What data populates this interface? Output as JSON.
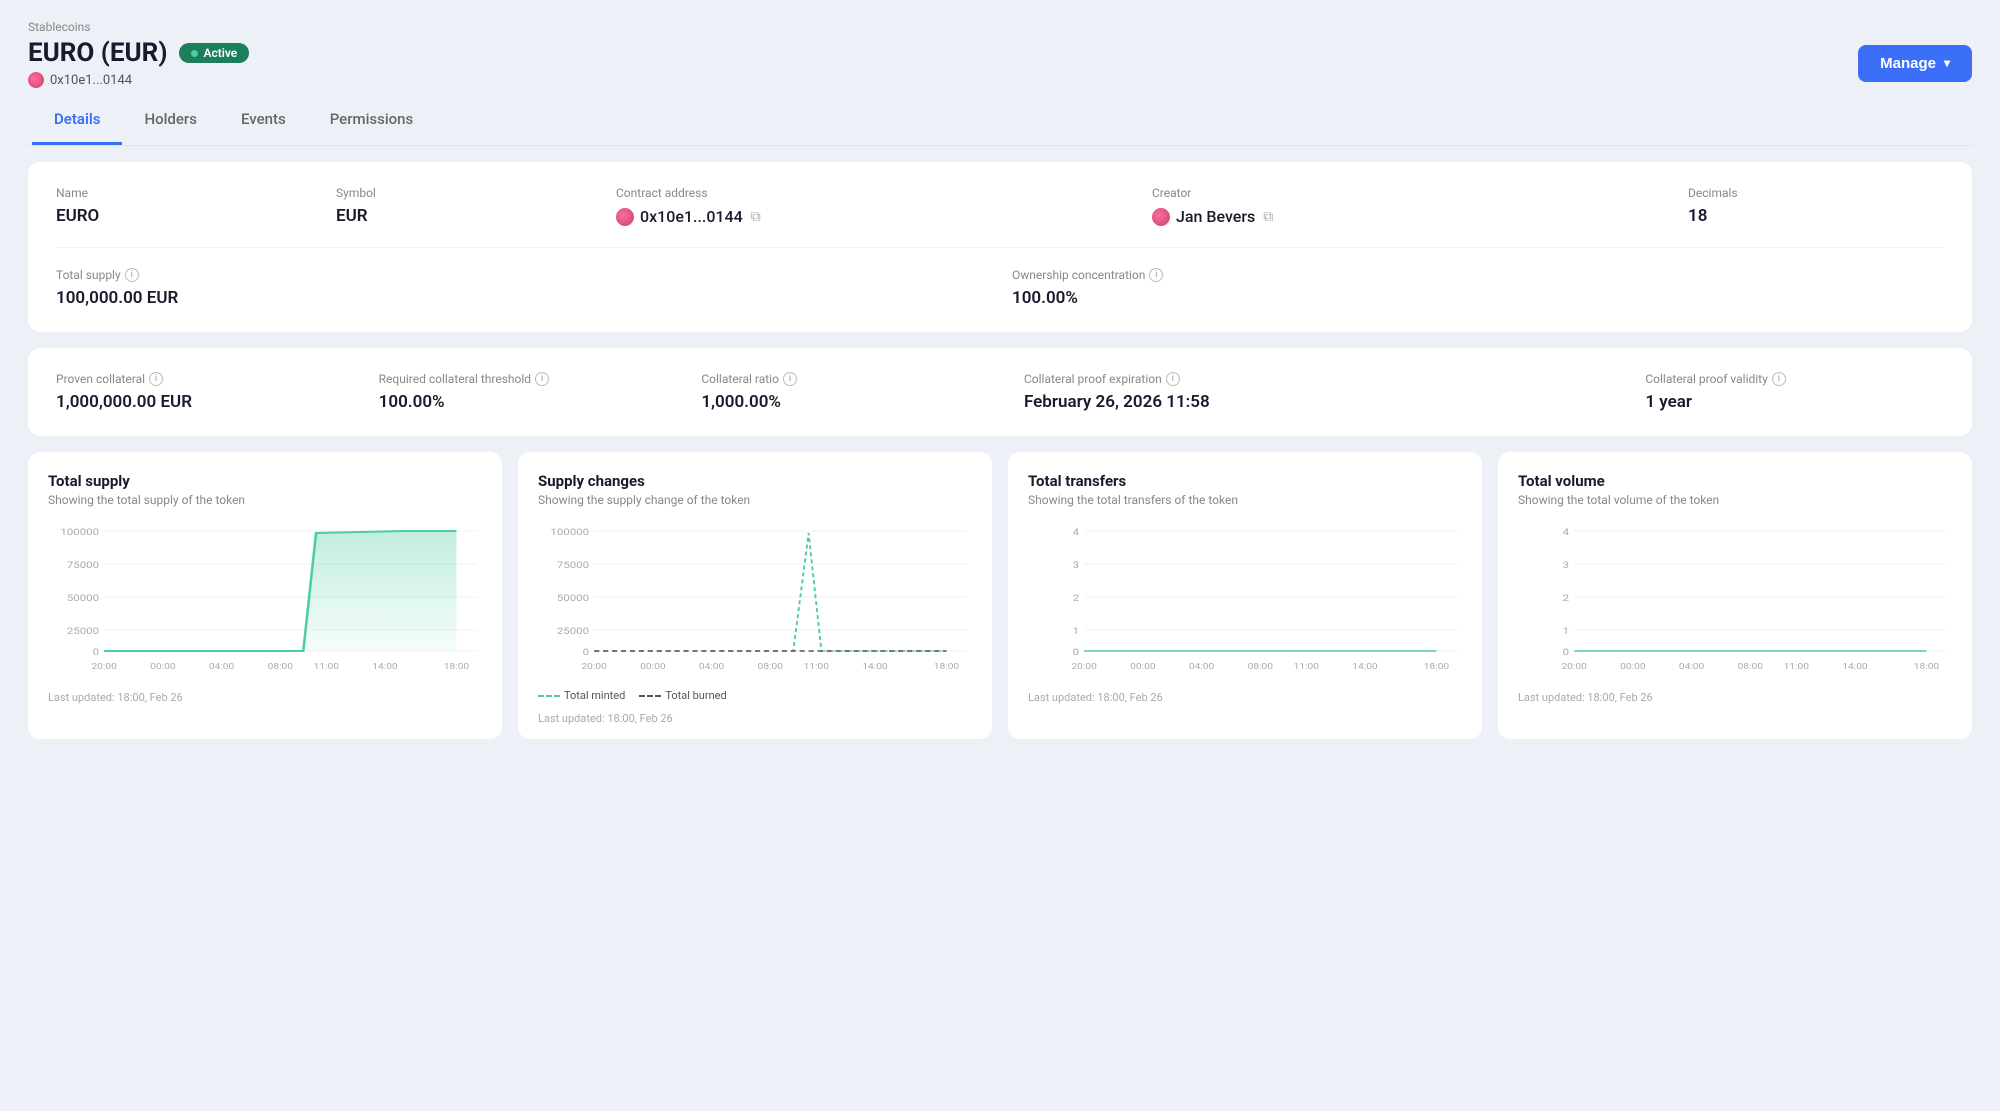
{
  "breadcrumb": "Stablecoins",
  "title": "EURO (EUR)",
  "status": "Active",
  "address": "0x10e1...0144",
  "manage_label": "Manage",
  "tabs": [
    "Details",
    "Holders",
    "Events",
    "Permissions"
  ],
  "active_tab": "Details",
  "details": {
    "name_label": "Name",
    "name_value": "EURO",
    "symbol_label": "Symbol",
    "symbol_value": "EUR",
    "contract_label": "Contract address",
    "contract_value": "0x10e1...0144",
    "creator_label": "Creator",
    "creator_value": "Jan Bevers",
    "decimals_label": "Decimals",
    "decimals_value": "18",
    "supply_label": "Total supply",
    "supply_value": "100,000.00 EUR",
    "ownership_label": "Ownership concentration",
    "ownership_value": "100.00%"
  },
  "collateral": {
    "proven_label": "Proven collateral",
    "proven_value": "1,000,000.00 EUR",
    "required_label": "Required collateral threshold",
    "required_value": "100.00%",
    "ratio_label": "Collateral ratio",
    "ratio_value": "1,000.00%",
    "expiration_label": "Collateral proof expiration",
    "expiration_value": "February 26, 2026 11:58",
    "validity_label": "Collateral proof validity",
    "validity_value": "1 year"
  },
  "charts": [
    {
      "title": "Total supply",
      "subtitle": "Showing the total supply of the token",
      "footer": "Last updated: 18:00, Feb 26",
      "type": "area",
      "x_labels": [
        "20:00",
        "00:00",
        "04:00",
        "08:00",
        "11:00",
        "14:00",
        "18:00"
      ],
      "y_labels": [
        "100000",
        "75000",
        "50000",
        "25000",
        "0"
      ],
      "legend": null
    },
    {
      "title": "Supply changes",
      "subtitle": "Showing the supply change of the token",
      "footer": "Last updated: 18:00, Feb 26",
      "type": "line_dual",
      "x_labels": [
        "20:00",
        "00:00",
        "04:00",
        "08:00",
        "11:00",
        "14:00",
        "18:00"
      ],
      "y_labels": [
        "100000",
        "75000",
        "50000",
        "25000",
        "0"
      ],
      "legend": [
        {
          "label": "Total minted",
          "style": "mint"
        },
        {
          "label": "Total burned",
          "style": "burn"
        }
      ]
    },
    {
      "title": "Total transfers",
      "subtitle": "Showing the total transfers of the token",
      "footer": "Last updated: 18:00, Feb 26",
      "type": "line_simple",
      "x_labels": [
        "20:00",
        "00:00",
        "04:00",
        "08:00",
        "11:00",
        "14:00",
        "18:00"
      ],
      "y_labels": [
        "4",
        "3",
        "2",
        "1",
        "0"
      ],
      "legend": null
    },
    {
      "title": "Total volume",
      "subtitle": "Showing the total volume of the token",
      "footer": "Last updated: 18:00, Feb 26",
      "type": "line_simple",
      "x_labels": [
        "20:00",
        "00:00",
        "04:00",
        "08:00",
        "11:00",
        "14:00",
        "18:00"
      ],
      "y_labels": [
        "4",
        "3",
        "2",
        "1",
        "0"
      ],
      "legend": null
    }
  ]
}
